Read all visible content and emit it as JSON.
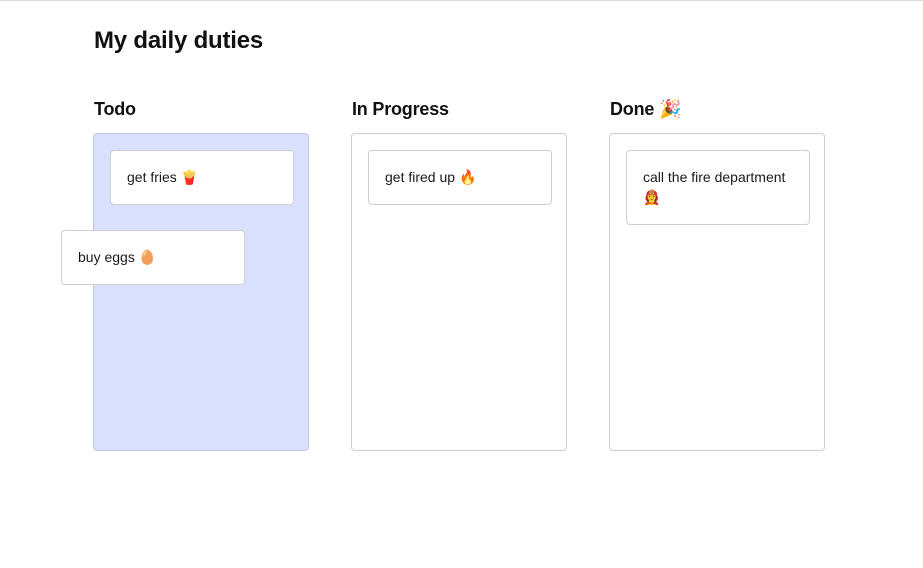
{
  "page": {
    "title": "My daily duties"
  },
  "columns": [
    {
      "title": "Todo",
      "emoji": "",
      "cards": [
        {
          "text": "get fries",
          "emoji": "🍟"
        }
      ]
    },
    {
      "title": "In Progress",
      "emoji": "",
      "cards": [
        {
          "text": "get fired up",
          "emoji": "🔥"
        }
      ]
    },
    {
      "title": "Done",
      "emoji": "🎉",
      "cards": [
        {
          "text": "call the fire department",
          "emoji": "👩‍🚒"
        }
      ]
    }
  ],
  "dragging_card": {
    "text": "buy eggs",
    "emoji": "🥚",
    "over_column": "Todo"
  },
  "colors": {
    "drop_target_background": "#d9e0fe",
    "card_border": "#cfcfcf",
    "column_border": "#cfcfcf"
  }
}
